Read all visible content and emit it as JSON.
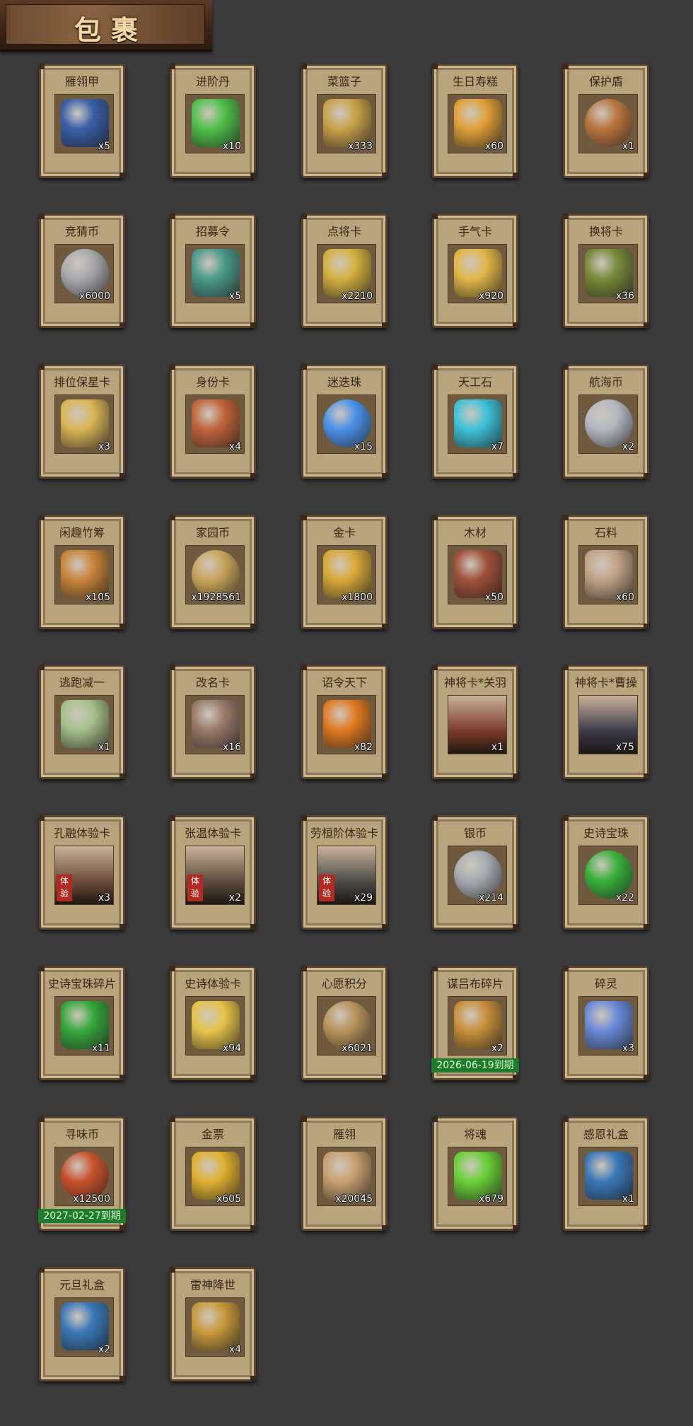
{
  "header": {
    "title": "包裹"
  },
  "items": [
    {
      "name": "雁翎甲",
      "count": "x5",
      "icon": "armor-icon",
      "color": "#3a5fa8"
    },
    {
      "name": "进阶丹",
      "count": "x10",
      "icon": "pill-icon",
      "color": "#4fc04a"
    },
    {
      "name": "菜篮子",
      "count": "x333",
      "icon": "basket-icon",
      "color": "#c9a24a"
    },
    {
      "name": "生日寿糕",
      "count": "x60",
      "icon": "cake-icon",
      "color": "#e0a038"
    },
    {
      "name": "保护盾",
      "count": "x1",
      "icon": "shield-icon",
      "color": "#b9743e"
    },
    {
      "name": "竞猜币",
      "count": "x6000",
      "icon": "coin-icon",
      "color": "#a7a9ad"
    },
    {
      "name": "招募令",
      "count": "x5",
      "icon": "token-icon",
      "color": "#4b9a8a"
    },
    {
      "name": "点将卡",
      "count": "x2210",
      "icon": "card-icon",
      "color": "#d4b040"
    },
    {
      "name": "手气卡",
      "count": "x920",
      "icon": "luck-card-icon",
      "color": "#e2b648"
    },
    {
      "name": "换将卡",
      "count": "x36",
      "icon": "swap-card-icon",
      "color": "#7a8a3a"
    },
    {
      "name": "排位保星卡",
      "count": "x3",
      "icon": "star-card-icon",
      "color": "#d9b555"
    },
    {
      "name": "身份卡",
      "count": "x4",
      "icon": "identity-card-icon",
      "color": "#c0643a"
    },
    {
      "name": "迷迭珠",
      "count": "x15",
      "icon": "orb-icon",
      "color": "#4a90e8"
    },
    {
      "name": "天工石",
      "count": "x7",
      "icon": "crystal-icon",
      "color": "#3ec2d8"
    },
    {
      "name": "航海币",
      "count": "x2",
      "icon": "coin-icon",
      "color": "#b4b8c2"
    },
    {
      "name": "闲趣竹筹",
      "count": "x105",
      "icon": "bamboo-icon",
      "color": "#c8843a"
    },
    {
      "name": "家园币",
      "count": "x1928561",
      "icon": "coin-icon",
      "color": "#c8a45a"
    },
    {
      "name": "金卡",
      "count": "x1800",
      "icon": "gold-card-icon",
      "color": "#d8a838"
    },
    {
      "name": "木材",
      "count": "x50",
      "icon": "wood-icon",
      "color": "#a0503a"
    },
    {
      "name": "石料",
      "count": "x60",
      "icon": "stone-icon",
      "color": "#c2a488"
    },
    {
      "name": "逃跑减一",
      "count": "x1",
      "icon": "tag-icon",
      "color": "#a6c08a"
    },
    {
      "name": "改名卡",
      "count": "x16",
      "icon": "rename-card-icon",
      "color": "#9a7a6a"
    },
    {
      "name": "诏令天下",
      "count": "x82",
      "icon": "scroll-icon",
      "color": "#e07a22"
    },
    {
      "name": "神将卡*关羽",
      "count": "x1",
      "icon": "portrait-icon",
      "color": "#7a3a2a"
    },
    {
      "name": "神将卡*曹操",
      "count": "x75",
      "icon": "portrait-icon",
      "color": "#3a3a4a"
    },
    {
      "name": "孔融体验卡",
      "count": "x3",
      "icon": "portrait-icon",
      "color": "#6a4a3a",
      "badge": "体验"
    },
    {
      "name": "张温体验卡",
      "count": "x2",
      "icon": "portrait-icon",
      "color": "#5a4a3e",
      "badge": "体验"
    },
    {
      "name": "劳桓阶体验卡",
      "count": "x29",
      "icon": "portrait-icon",
      "color": "#4a4a4a",
      "badge": "体验"
    },
    {
      "name": "银币",
      "count": "x214",
      "icon": "silver-coin-icon",
      "color": "#a6acb2"
    },
    {
      "name": "史诗宝珠",
      "count": "x22",
      "icon": "orb-icon",
      "color": "#38b03a"
    },
    {
      "name": "史诗宝珠碎片",
      "count": "x11",
      "icon": "shard-icon",
      "color": "#36a83c"
    },
    {
      "name": "史诗体验卡",
      "count": "x94",
      "icon": "gold-card-icon",
      "color": "#e6c44a"
    },
    {
      "name": "心愿积分",
      "count": "x6021",
      "icon": "heart-coin-icon",
      "color": "#b8925a"
    },
    {
      "name": "谋吕布碎片",
      "count": "x2",
      "icon": "puzzle-icon",
      "color": "#c8903a",
      "expiry": "2026-06-19到期"
    },
    {
      "name": "碎灵",
      "count": "x3",
      "icon": "crystal-icon",
      "color": "#6a8ad8"
    },
    {
      "name": "寻味币",
      "count": "x12500",
      "icon": "coin-icon",
      "color": "#c8502a",
      "expiry": "2027-02-27到期"
    },
    {
      "name": "金票",
      "count": "x605",
      "icon": "ticket-icon",
      "color": "#e0b030"
    },
    {
      "name": "雁翎",
      "count": "x20045",
      "icon": "feather-icon",
      "color": "#c8a070"
    },
    {
      "name": "将魂",
      "count": "x679",
      "icon": "soul-icon",
      "color": "#6ad038"
    },
    {
      "name": "感恩礼盒",
      "count": "x1",
      "icon": "gift-box-icon",
      "color": "#3a78b8"
    },
    {
      "name": "元旦礼盒",
      "count": "x2",
      "icon": "gift-box-icon",
      "color": "#3a78b8"
    },
    {
      "name": "雷神降世",
      "count": "x4",
      "icon": "gift-box-icon",
      "color": "#c89a3a"
    }
  ]
}
